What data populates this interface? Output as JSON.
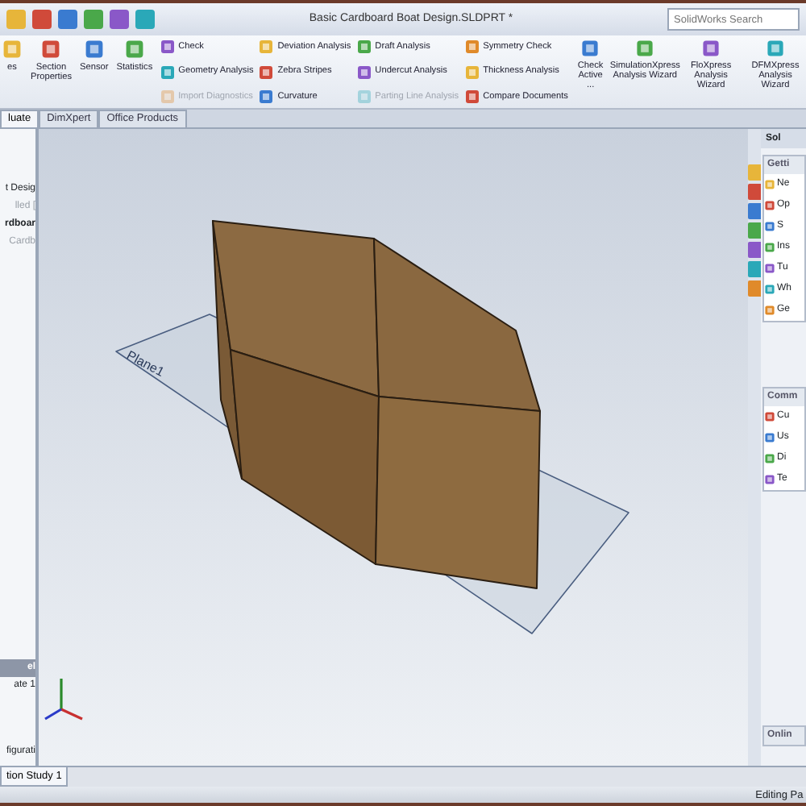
{
  "window": {
    "title": "Basic Cardboard Boat Design.SLDPRT *"
  },
  "search": {
    "placeholder": "SolidWorks Search"
  },
  "ribbon": {
    "large_left": [
      {
        "label": "es"
      },
      {
        "label": "Section Properties"
      },
      {
        "label": "Sensor"
      },
      {
        "label": "Statistics"
      }
    ],
    "columns": [
      [
        {
          "label": "Check",
          "disabled": false
        },
        {
          "label": "Geometry Analysis",
          "disabled": false
        },
        {
          "label": "Import Diagnostics",
          "disabled": true
        }
      ],
      [
        {
          "label": "Deviation Analysis",
          "disabled": false
        },
        {
          "label": "Zebra Stripes",
          "disabled": false
        },
        {
          "label": "Curvature",
          "disabled": false
        }
      ],
      [
        {
          "label": "Draft Analysis",
          "disabled": false
        },
        {
          "label": "Undercut Analysis",
          "disabled": false
        },
        {
          "label": "Parting Line Analysis",
          "disabled": true
        }
      ],
      [
        {
          "label": "Symmetry Check",
          "disabled": false
        },
        {
          "label": "Thickness Analysis",
          "disabled": false
        },
        {
          "label": "Compare Documents",
          "disabled": false
        }
      ]
    ],
    "large_right": [
      {
        "label": "Check Active ..."
      },
      {
        "label": "SimulationXpress Analysis Wizard"
      },
      {
        "label": "FloXpress Analysis Wizard"
      },
      {
        "label": "DFMXpress Analysis Wizard"
      }
    ]
  },
  "tabs": [
    {
      "label": "luate",
      "selected": true
    },
    {
      "label": "DimXpert",
      "selected": false
    },
    {
      "label": "Office Products",
      "selected": false
    }
  ],
  "feature_tree": {
    "items": [
      {
        "label": "t Desig",
        "kind": "normal"
      },
      {
        "label": "lled [",
        "kind": "dim"
      },
      {
        "label": "rdboar",
        "kind": "bold"
      },
      {
        "label": "Cardb",
        "kind": "dim"
      }
    ],
    "lower_header": "el",
    "lower_items": [
      "ate 1",
      "figurati"
    ]
  },
  "viewport": {
    "plane_label": "Plane1"
  },
  "task_pane": {
    "title": "Sol",
    "sections": [
      {
        "title": "Getti",
        "items": [
          "Ne",
          "Op",
          "S",
          "Ins",
          "Tu",
          "Wh",
          "Ge"
        ]
      },
      {
        "title": "Comm",
        "items": [
          "Cu",
          "Us",
          "Di",
          "Te"
        ]
      },
      {
        "title": "Onlin"
      }
    ]
  },
  "bottom_tabs": [
    {
      "label": "tion Study 1",
      "selected": true
    }
  ],
  "status_bar": {
    "text": "Editing Pa"
  }
}
